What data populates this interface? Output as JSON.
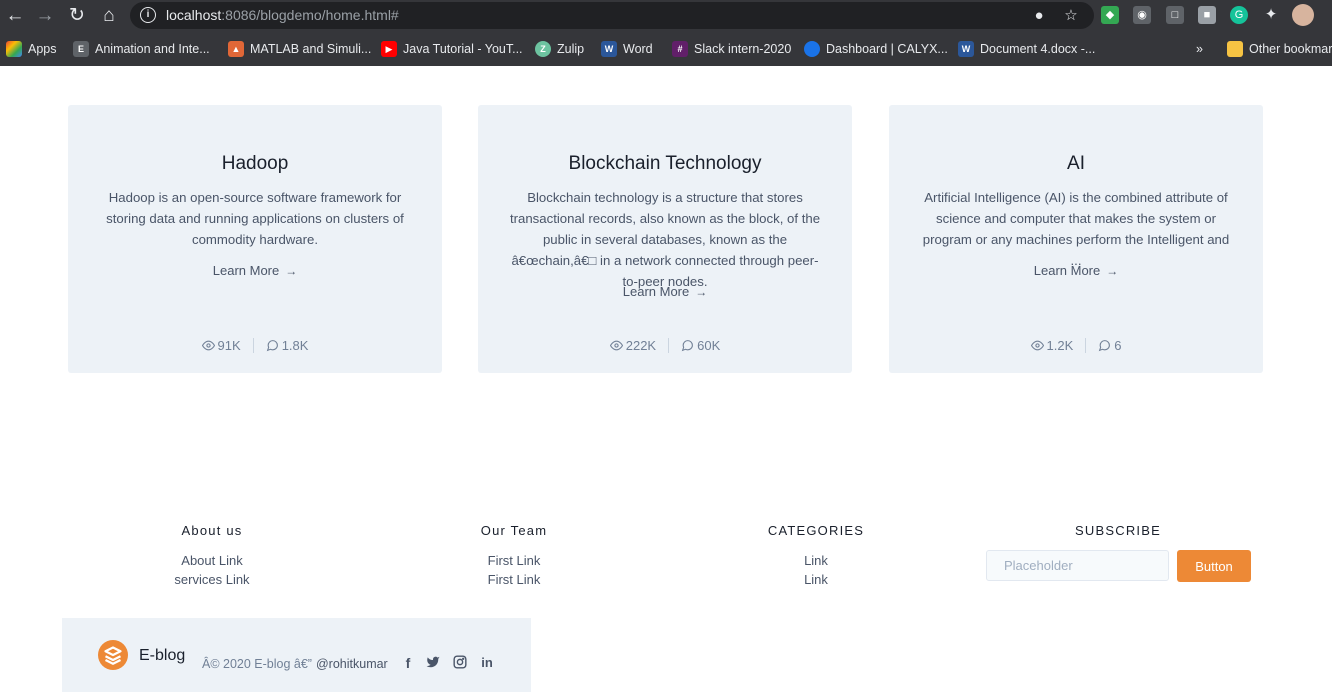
{
  "browser": {
    "url_host": "localhost",
    "url_rest": ":8086/blogdemo/home.html#",
    "bookmarks": [
      {
        "label": "Apps",
        "icon": "apps-grid-icon",
        "color": "#ea4335"
      },
      {
        "label": "Animation and Inte...",
        "icon": "notebook-icon",
        "color": "#5f6368"
      },
      {
        "label": "MATLAB and Simuli...",
        "icon": "matlab-icon",
        "color": "#e16737"
      },
      {
        "label": "Java Tutorial - YouT...",
        "icon": "youtube-icon",
        "color": "#ff0000"
      },
      {
        "label": "Zulip",
        "icon": "zulip-icon",
        "color": "#6dc3a0"
      },
      {
        "label": "Word",
        "icon": "word-icon",
        "color": "#2b579a"
      },
      {
        "label": "Slack intern-2020",
        "icon": "slack-icon",
        "color": "#611f69"
      },
      {
        "label": "Dashboard | CALYX...",
        "icon": "calyx-icon",
        "color": "#1a73e8"
      },
      {
        "label": "Document 4.docx -...",
        "icon": "word-icon",
        "color": "#2b579a"
      }
    ],
    "overflow_label": "»",
    "other_bookmarks": "Other bookmarks"
  },
  "cards": [
    {
      "title": "Hadoop",
      "description": "Hadoop is an open-source software framework for storing data and running applications on clusters of commodity hardware.",
      "learn_more": "Learn More",
      "views": "91K",
      "comments": "1.8K"
    },
    {
      "title": "Blockchain Technology",
      "description": "Blockchain technology is a structure that stores transactional records, also known as the block, of the public in several databases, known as the â€œchain,â€□ in a network connected through peer-to-peer nodes.",
      "learn_more": "Learn More",
      "views": "222K",
      "comments": "60K"
    },
    {
      "title": "AI",
      "description": "Artificial Intelligence (AI) is the combined attribute of science and computer that makes the system or program or any machines perform the Intelligent and ...",
      "learn_more": "Learn More",
      "views": "1.2K",
      "comments": "6"
    }
  ],
  "footer": {
    "about": {
      "heading": "About us",
      "links": [
        "About Link",
        "services Link"
      ]
    },
    "team": {
      "heading": "Our Team",
      "links": [
        "First Link",
        "First Link"
      ]
    },
    "categories": {
      "heading": "CATEGORIES",
      "links": [
        "Link",
        "Link"
      ]
    },
    "subscribe": {
      "heading": "SUBSCRIBE",
      "placeholder": "Placeholder",
      "button": "Button"
    },
    "brand": "E-blog",
    "copyright": "Â© 2020 E-blog â€”",
    "handle": "@rohitkumar",
    "accent": "#ed8936"
  }
}
